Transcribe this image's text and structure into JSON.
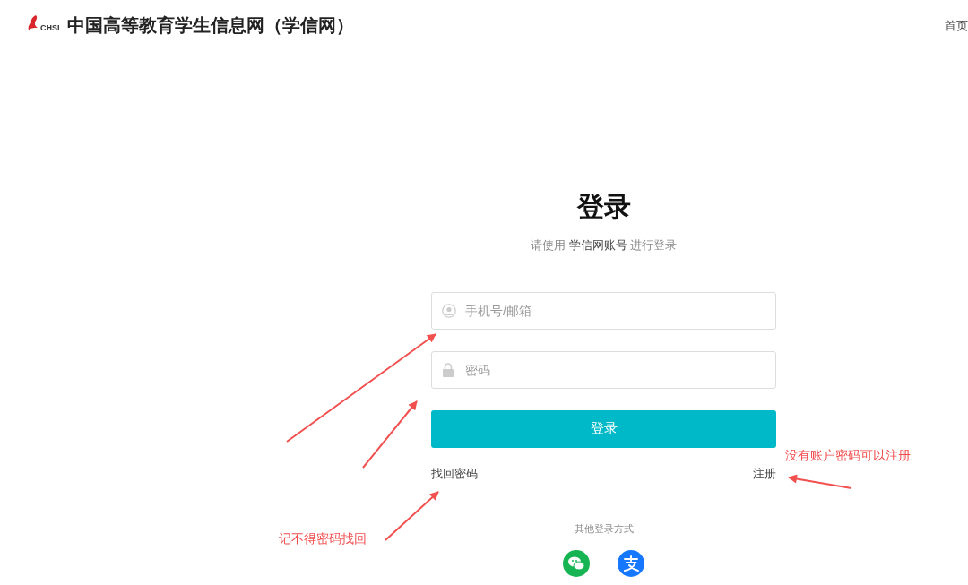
{
  "header": {
    "logo_caption": "CHSI",
    "site_title": "中国高等教育学生信息网（学信网）",
    "nav_link": "首页"
  },
  "login": {
    "title": "登录",
    "subtitle": "请使用 **学信网账号** 进行登录",
    "fields": [
      {
        "kind": "user",
        "placeholder": "手机号/邮箱"
      },
      {
        "kind": "password",
        "placeholder": "密码"
      }
    ],
    "submit": "登录",
    "forgot_link": "找回密码",
    "register_link": "注册",
    "other_methods_label": "其他登录方式"
  },
  "annotations": [
    {
      "text": "没有账户密码可以注册"
    },
    {
      "text": "记不得密码找回"
    }
  ]
}
